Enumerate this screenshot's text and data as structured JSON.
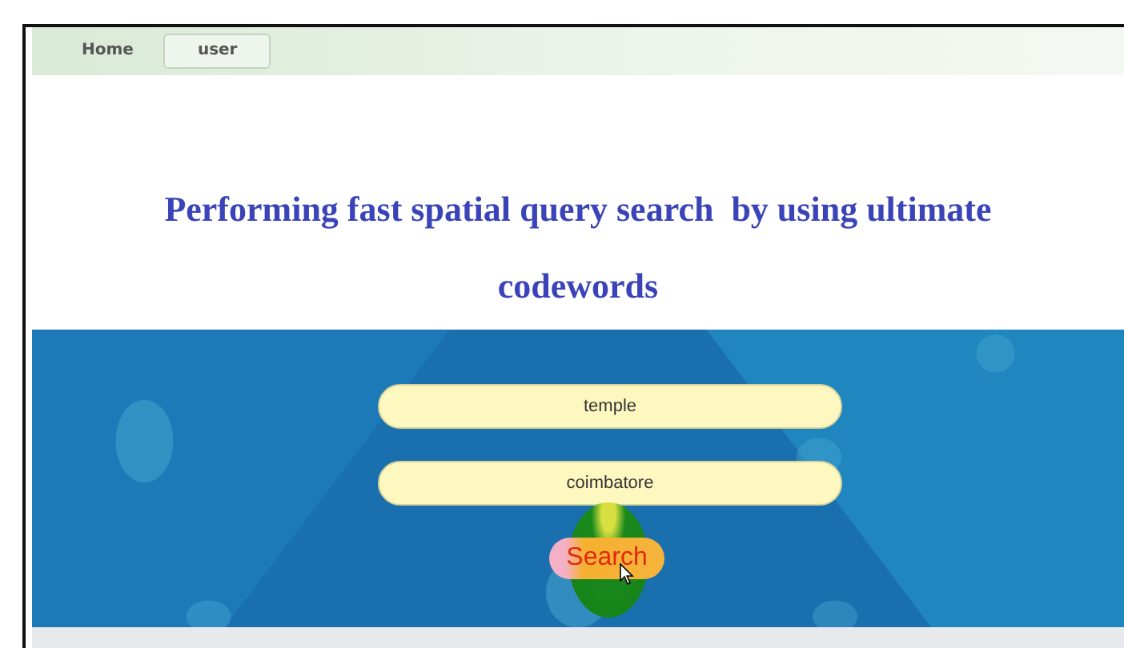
{
  "nav": [
    {
      "label": "Home",
      "selected": false
    },
    {
      "label": "user",
      "selected": true
    }
  ],
  "title": "Performing fast spatial query search  by using ultimate codewords",
  "fields": [
    {
      "value": "temple"
    },
    {
      "value": "coimbatore"
    }
  ],
  "search_button": {
    "label": "Search"
  }
}
